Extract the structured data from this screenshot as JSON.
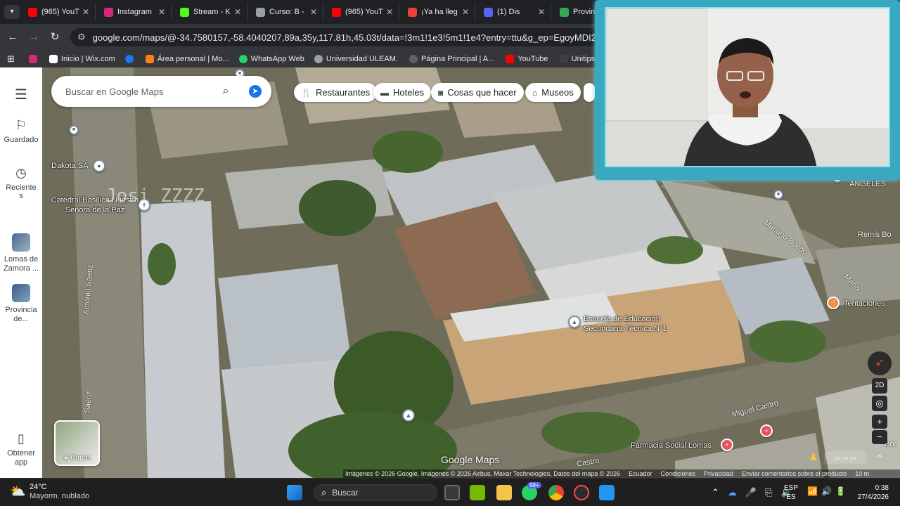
{
  "browser": {
    "tabs": [
      {
        "title": "(965) YouT",
        "color": "#ff0000"
      },
      {
        "title": "Instagram",
        "color": "#d62976"
      },
      {
        "title": "Stream - K",
        "color": "#53fc18"
      },
      {
        "title": "Curso: B -",
        "color": "#9aa0a6"
      },
      {
        "title": "(965) YouT",
        "color": "#ff0000"
      },
      {
        "title": "¡Ya ha lleg",
        "color": "#ea4335"
      },
      {
        "title": "(1) Dis",
        "color": "#5865f2"
      },
      {
        "title": "Provincia",
        "color": "#34a853"
      }
    ],
    "tab_close": "✕",
    "url": "google.com/maps/@-34.7580157,-58.4040207,89a,35y,117.81h,45.03t/data=!3m1!1e3!5m1!1e4?entry=ttu&g_ep=EgoyMDI2MDQyMi4wIKX",
    "bookmarks": [
      {
        "label": "",
        "color": "#d62976"
      },
      {
        "label": "Inicio | Wix.com",
        "color": "#ffffff"
      },
      {
        "label": "",
        "color": "#1877f2"
      },
      {
        "label": "Área personal | Mo...",
        "color": "#f98012"
      },
      {
        "label": "WhatsApp Web",
        "color": "#25d366"
      },
      {
        "label": "Universidad ULEAM.",
        "color": "#9aa0a6"
      },
      {
        "label": "Página Principal | A...",
        "color": "#5f6368"
      },
      {
        "label": "YouTube",
        "color": "#ff0000"
      },
      {
        "label": "Unitips | Cursos pa",
        "color": "#3c4043"
      }
    ]
  },
  "rail": {
    "saved": "Guardado",
    "recent": "Recientes",
    "place1": "Lomas de Zamora ...",
    "place2": "Provincia de...",
    "get_app": "Obtener app"
  },
  "search": {
    "placeholder": "Buscar en Google Maps"
  },
  "chips": [
    "Restaurantes",
    "Hoteles",
    "Cosas que hacer",
    "Museos"
  ],
  "map_labels": {
    "dakota": "Dakota SA",
    "catedral": "Catedral Basílica Nuestra Señora de la Paz",
    "escuela": "Escuela de Educación Secundaria Técnica N°1",
    "tentaciones": "Tentaciones",
    "farmacia": "Farmacia Social Lomas",
    "angeles": "ANGELES",
    "remis": "Remis Bo",
    "mariano_boedo": "Mariano Boedo",
    "antonio_saenz": "Antonio Sáenz",
    "miguel_castro": "Miguel Castro",
    "maria": "Maria",
    "castro": "Castro",
    "saenz": "Sáenz",
    "bor": "Bor",
    "watermark": "Josi ZZZZ"
  },
  "layers_label": "Capas",
  "brand": "Google Maps",
  "attribution": [
    "Imágenes © 2026 Google, Imágenes © 2026 Airbus, Maxar Technologies, Datos del mapa © 2026",
    "Ecuador",
    "Condiciones",
    "Privacidad",
    "Enviar comentarios sobre el producto",
    "10 m"
  ],
  "view_toggle": "2D",
  "taskbar": {
    "temp": "24°C",
    "weather": "Mayorm. nublado",
    "search": "Buscar",
    "lang1": "ESP",
    "lang2": "ES",
    "time": "0:38",
    "date": "27/4/2026",
    "badge": "99+"
  },
  "icons": {
    "back": "arrow-left-icon",
    "forward": "arrow-right-icon",
    "reload": "reload-icon",
    "menu": "hamburger-menu-icon",
    "saved": "bookmark-icon",
    "recent": "history-icon",
    "search": "search-icon",
    "directions": "directions-icon"
  }
}
